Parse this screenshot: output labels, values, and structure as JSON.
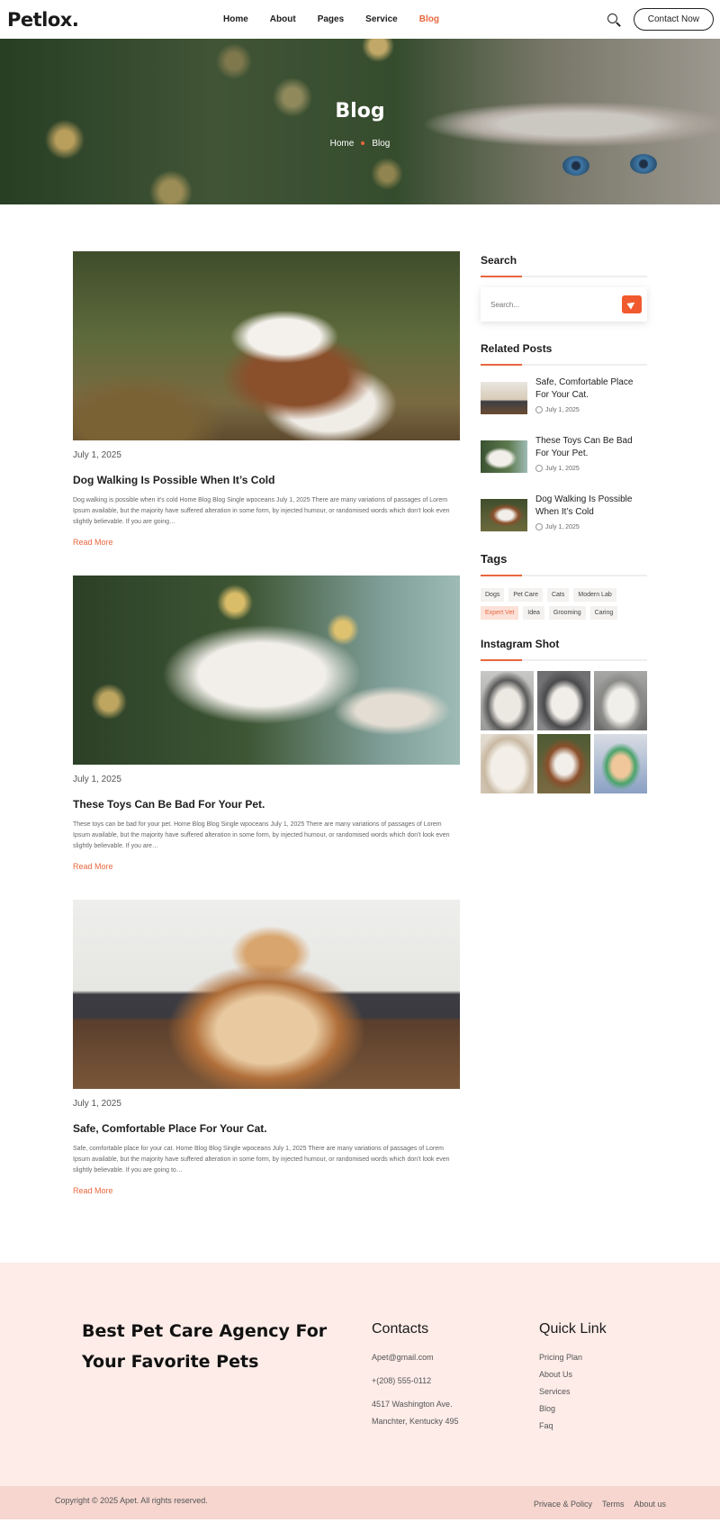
{
  "header": {
    "logo": "Petlox.",
    "nav": [
      "Home",
      "About",
      "Pages",
      "Service",
      "Blog"
    ],
    "active_nav": "Blog",
    "contact_label": "Contact Now"
  },
  "hero": {
    "title": "Blog",
    "crumb_home": "Home",
    "crumb_current": "Blog"
  },
  "posts": [
    {
      "date": "July 1, 2025",
      "title": "Dog Walking Is Possible When It’s Cold",
      "excerpt": "Dog walking is possible when it’s cold Home Blog Blog Single wpoceans July 1, 2025 There are many variations of passages of Lorem Ipsum available, but the majority have suffered alteration in some form, by injected humour, or randomised words which don’t look even slightly believable. If you are going…",
      "more": "Read More"
    },
    {
      "date": "July 1, 2025",
      "title": "These Toys Can Be Bad For Your Pet.",
      "excerpt": "These toys can be bad for your pet. Home Blog Blog Single wpoceans July 1, 2025 There are many variations of passages of Lorem Ipsum available, but the majority have suffered alteration in some form, by injected humour, or randomised words which don’t look even slightly believable. If you are…",
      "more": "Read More"
    },
    {
      "date": "July 1, 2025",
      "title": "Safe, Comfortable Place For Your Cat.",
      "excerpt": "Safe, comfortable place for your cat. Home Blog Blog Single wpoceans July 1, 2025 There are many variations of passages of Lorem Ipsum available, but the majority have suffered alteration in some form, by injected humour, or randomised words which don’t look even slightly believable. If you are going to…",
      "more": "Read More"
    }
  ],
  "sidebar": {
    "search_heading": "Search",
    "search_placeholder": "Search...",
    "related_heading": "Related Posts",
    "related": [
      {
        "title": "Safe, Comfortable Place For Your Cat.",
        "date": "July 1, 2025"
      },
      {
        "title": "These Toys Can Be Bad For Your Pet.",
        "date": "July 1, 2025"
      },
      {
        "title": "Dog Walking Is Possible When It’s Cold",
        "date": "July 1, 2025"
      }
    ],
    "tags_heading": "Tags",
    "tags": [
      "Dogs",
      "Pet Care",
      "Cats",
      "Modern Lab",
      "Expert Vet",
      "Idea",
      "Grooming",
      "Caring"
    ],
    "insta_heading": "Instagram Shot"
  },
  "footer": {
    "tagline": "Best Pet Care Agency For Your Favorite Pets",
    "contacts_heading": "Contacts",
    "email": "Apet@gmail.com",
    "phone": "+(208) 555-0112",
    "address_line1": "4517 Washington Ave.",
    "address_line2": "Manchter, Kentucky 495",
    "quick_heading": "Quick Link",
    "quick_links": [
      "Pricing Plan",
      "About Us",
      "Services",
      "Blog",
      "Faq"
    ],
    "copyright": "Copyright © 2025 Apet. All rights reserved.",
    "bottom_links": [
      "Privace & Policy",
      "Terms",
      "About us"
    ]
  },
  "colors": {
    "accent": "#e8673e",
    "footer_bg": "#fdece8",
    "bottom_bar": "#f6d6cf"
  }
}
